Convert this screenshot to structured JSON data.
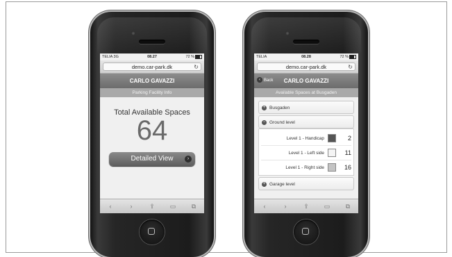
{
  "colors": {
    "accent": "#767676",
    "background": "#ffffff"
  },
  "left_phone": {
    "status": {
      "carrier": "TELIA  3G",
      "time": "08.27",
      "battery": "72 %"
    },
    "url": "demo.car-park.dk",
    "reload_icon": "↻",
    "app_title": "CARLO GAVAZZI",
    "subtitle": "Parking Facility Info",
    "total_label": "Total Available Spaces",
    "total_value": "64",
    "detail_button": "Detailed View",
    "toolbar": [
      "‹",
      "›",
      "⇪",
      "▭",
      "⧉"
    ]
  },
  "right_phone": {
    "status": {
      "carrier": "TELIA",
      "time": "08.28",
      "battery": "72 %"
    },
    "url": "demo.car-park.dk",
    "reload_icon": "↻",
    "back_label": "Back",
    "app_title": "CARLO GAVAZZI",
    "subtitle": "Available Spaces at Busgaden",
    "sections": [
      {
        "label": "Busgaden",
        "state": "collapsed"
      },
      {
        "label": "Ground level",
        "state": "expanded"
      },
      {
        "label": "Garage level",
        "state": "collapsed"
      }
    ],
    "levels": [
      {
        "name": "Level 1 - Handicap",
        "count": "2",
        "color": "#555555"
      },
      {
        "name": "Level 1 - Left side",
        "count": "11",
        "color": "#f4f4f4"
      },
      {
        "name": "Level 1 - Right side",
        "count": "16",
        "color": "#c4c4c4"
      }
    ],
    "toolbar": [
      "‹",
      "›",
      "⇪",
      "▭",
      "⧉"
    ]
  }
}
